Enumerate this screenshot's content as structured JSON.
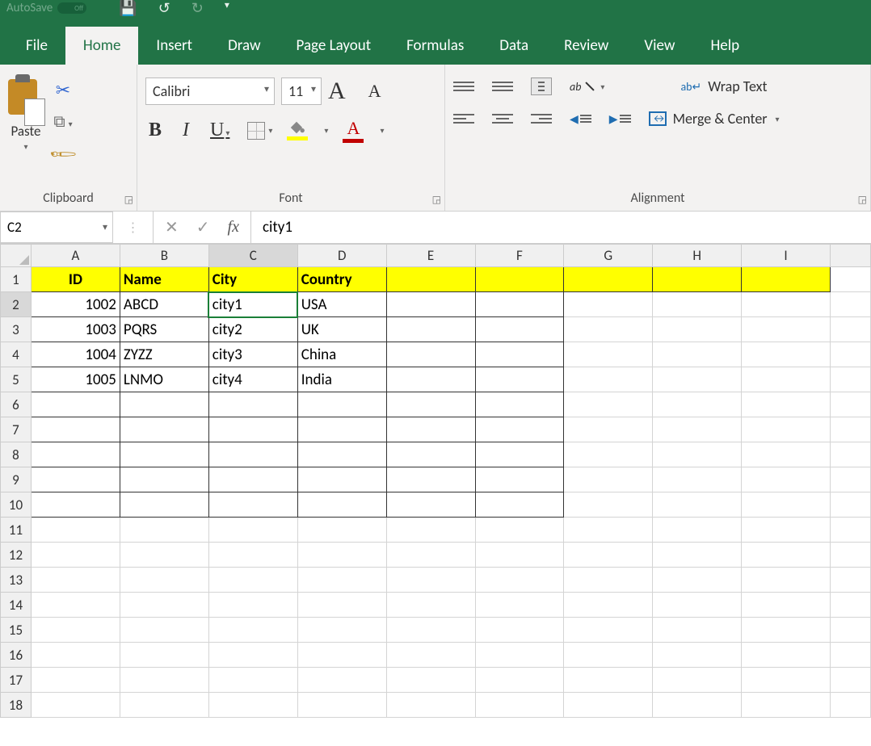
{
  "titlebar": {
    "autosave_label": "AutoSave",
    "autosave_state": "Off"
  },
  "tabs": {
    "file": "File",
    "home": "Home",
    "insert": "Insert",
    "draw": "Draw",
    "pagelayout": "Page Layout",
    "formulas": "Formulas",
    "data": "Data",
    "review": "Review",
    "view": "View",
    "help": "Help"
  },
  "ribbon": {
    "clipboard": {
      "paste": "Paste",
      "label": "Clipboard"
    },
    "font": {
      "name": "Calibri",
      "size": "11",
      "label": "Font"
    },
    "alignment": {
      "wrap": "Wrap Text",
      "merge": "Merge & Center",
      "label": "Alignment"
    }
  },
  "formula_bar": {
    "namebox": "C2",
    "value": "city1"
  },
  "columns": [
    "A",
    "B",
    "C",
    "D",
    "E",
    "F",
    "G",
    "H",
    "I"
  ],
  "rows": [
    "1",
    "2",
    "3",
    "4",
    "5",
    "6",
    "7",
    "8",
    "9",
    "10",
    "11",
    "12",
    "13",
    "14",
    "15",
    "16",
    "17",
    "18"
  ],
  "selected_col": "C",
  "selected_row": "2",
  "table": {
    "headers": {
      "A": "ID",
      "B": "Name",
      "C": "City",
      "D": "Country"
    },
    "data": [
      {
        "A": "1002",
        "B": "ABCD",
        "C": "city1",
        "D": "USA"
      },
      {
        "A": "1003",
        "B": "PQRS",
        "C": "city2",
        "D": "UK"
      },
      {
        "A": "1004",
        "B": "ZYZZ",
        "C": "city3",
        "D": "China"
      },
      {
        "A": "1005",
        "B": "LNMO",
        "C": "city4",
        "D": "India"
      }
    ]
  }
}
